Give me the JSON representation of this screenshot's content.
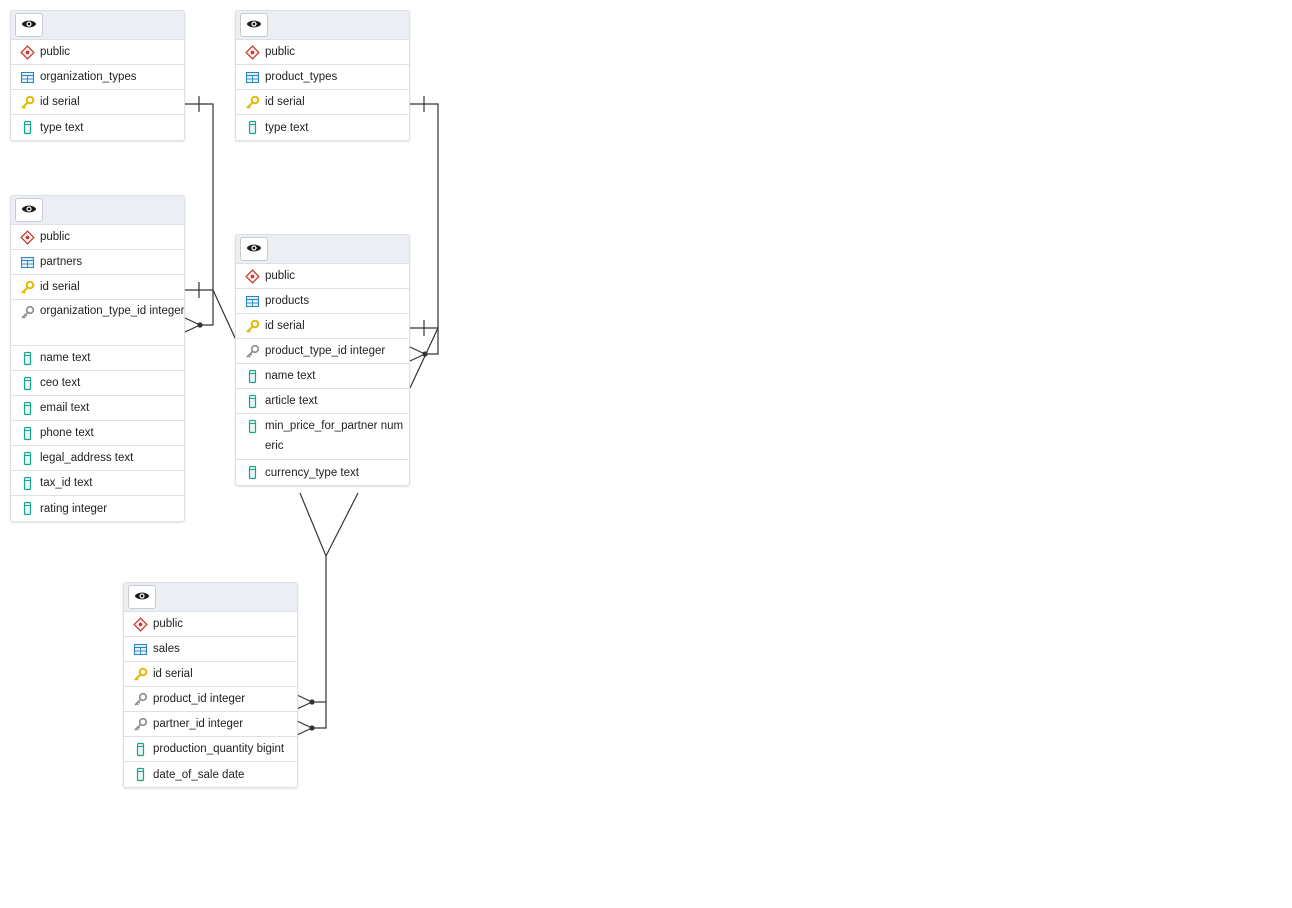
{
  "colors": {
    "schema_icon": "#c0392b",
    "table_icon": "#2e86c1",
    "pk_icon": "#e6b800",
    "fk_icon": "#8a8a8a",
    "column_icon": "#17a589",
    "relation_line": "#333333"
  },
  "icons": {
    "view": "eye-icon",
    "schema": "schema-icon",
    "table": "table-icon",
    "primary_key": "primary-key-icon",
    "foreign_key": "foreign-key-icon",
    "column": "column-icon"
  },
  "tables": {
    "organization_types": {
      "schema": "public",
      "name": "organization_types",
      "columns": [
        "id serial",
        "type text"
      ]
    },
    "product_types": {
      "schema": "public",
      "name": "product_types",
      "columns": [
        "id serial",
        "type text"
      ]
    },
    "partners": {
      "schema": "public",
      "name": "partners",
      "columns": [
        "id serial",
        "organization_type_id integer",
        "name text",
        "ceo text",
        "email text",
        "phone text",
        "legal_address text",
        "tax_id text",
        "rating integer"
      ]
    },
    "products": {
      "schema": "public",
      "name": "products",
      "columns": [
        "id serial",
        "product_type_id integer",
        "name text",
        "article text",
        "min_price_for_partner numeric",
        "currency_type text"
      ]
    },
    "sales": {
      "schema": "public",
      "name": "sales",
      "columns": [
        "id serial",
        "product_id integer",
        "partner_id integer",
        "production_quantity bigint",
        "date_of_sale date"
      ]
    }
  }
}
